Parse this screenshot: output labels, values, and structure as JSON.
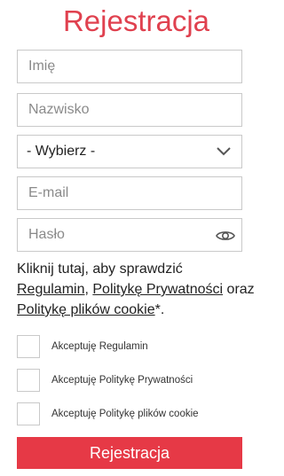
{
  "title": "Rejestracja",
  "fields": {
    "first_name_placeholder": "Imię",
    "last_name_placeholder": "Nazwisko",
    "select_value": "- Wybierz -",
    "email_placeholder": "E-mail",
    "password_placeholder": "Hasło"
  },
  "info": {
    "text_before": "Kliknij tutaj, aby sprawdzić ",
    "link_terms": "Regulamin",
    "comma": ", ",
    "link_privacy": "Politykę Prywatności",
    "oraz": " oraz ",
    "link_cookies": "Politykę plików cookie",
    "suffix": "*."
  },
  "checkboxes": [
    {
      "label": "Akceptuję Regulamin",
      "checked": false
    },
    {
      "label": "Akceptuję Politykę Prywatności",
      "checked": false
    },
    {
      "label": "Akceptuję Politykę plików cookie",
      "checked": false
    }
  ],
  "submit_label": "Rejestracja",
  "colors": {
    "accent": "#e63946",
    "title": "#e0414f",
    "border": "#c9c9c9"
  },
  "icons": {
    "select": "chevron-down-icon",
    "password": "eye-icon"
  }
}
